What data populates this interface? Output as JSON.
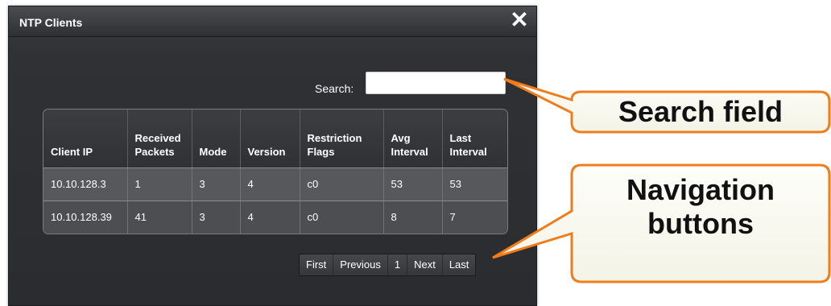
{
  "dialog": {
    "title": "NTP Clients",
    "close_glyph": "✕",
    "search": {
      "label": "Search:",
      "value": "",
      "placeholder": ""
    }
  },
  "table": {
    "headers": [
      [
        "Client IP",
        ""
      ],
      [
        "Received",
        "Packets"
      ],
      [
        "Mode",
        ""
      ],
      [
        "Version",
        ""
      ],
      [
        "Restriction",
        "Flags"
      ],
      [
        "Avg",
        "Interval"
      ],
      [
        "Last",
        "Interval"
      ]
    ],
    "rows": [
      [
        "10.10.128.3",
        "1",
        "3",
        "4",
        "c0",
        "53",
        "53"
      ],
      [
        "10.10.128.39",
        "41",
        "3",
        "4",
        "c0",
        "8",
        "7"
      ]
    ]
  },
  "pager": {
    "first": "First",
    "previous": "Previous",
    "page": "1",
    "next": "Next",
    "last": "Last"
  },
  "callouts": {
    "search": "Search field",
    "navigation_line1": "Navigation",
    "navigation_line2": "buttons"
  },
  "colors": {
    "callout_border": "#f07c1c",
    "callout_fill": "#fbfbf2"
  }
}
